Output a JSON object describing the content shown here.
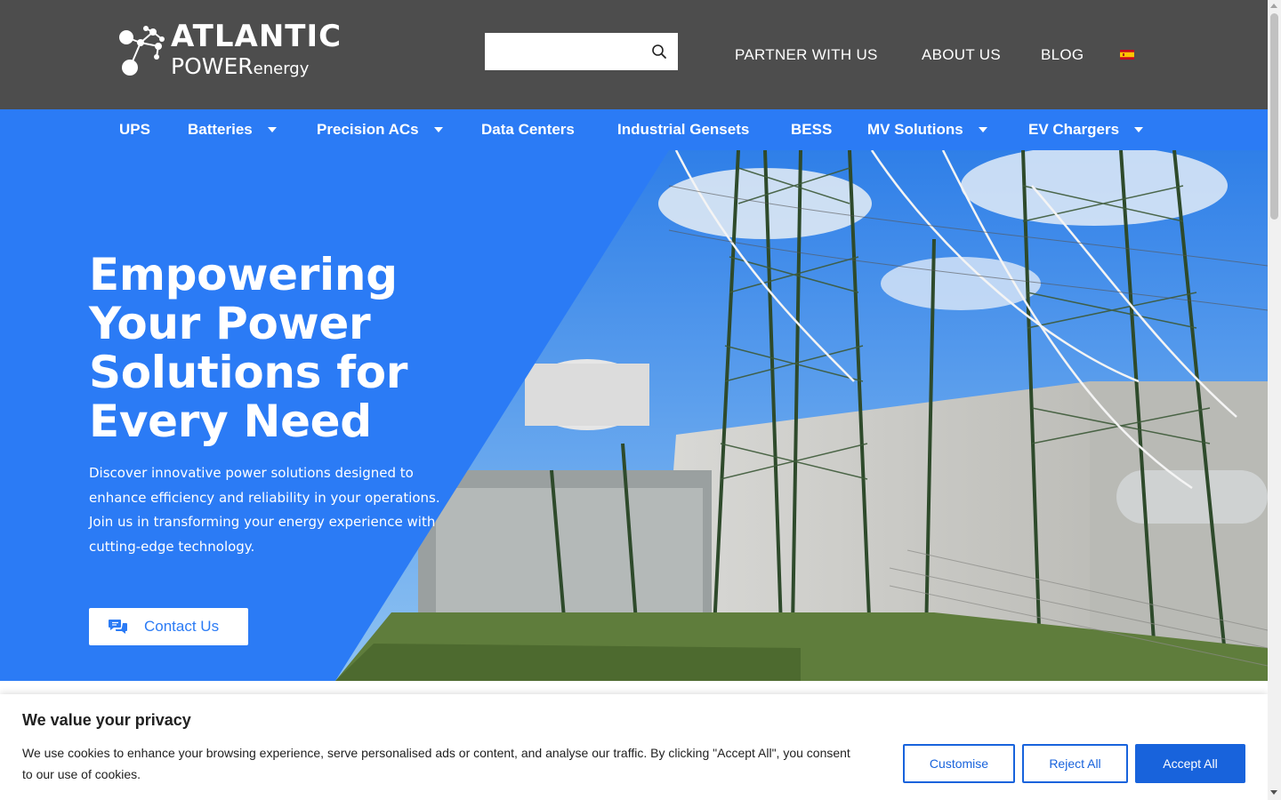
{
  "header": {
    "logo": {
      "line1": "ATLANTIC",
      "line2_main": "POWER",
      "line2_small": "energy"
    },
    "search": {
      "placeholder": "",
      "value": "",
      "icon": "search-icon"
    },
    "links": [
      {
        "label": "PARTNER WITH US"
      },
      {
        "label": "ABOUT US"
      },
      {
        "label": "BLOG"
      }
    ],
    "language_flag": "spain-flag-icon"
  },
  "main_nav": {
    "items": [
      {
        "label": "UPS",
        "has_dropdown": false
      },
      {
        "label": "Batteries",
        "has_dropdown": true
      },
      {
        "label": "Precision ACs",
        "has_dropdown": true
      },
      {
        "label": "Data Centers",
        "has_dropdown": false
      },
      {
        "label": "Industrial Gensets",
        "has_dropdown": false
      },
      {
        "label": "BESS",
        "has_dropdown": false
      },
      {
        "label": "MV Solutions",
        "has_dropdown": true
      },
      {
        "label": "EV Chargers",
        "has_dropdown": true
      }
    ]
  },
  "hero": {
    "title_lines": [
      "Empowering",
      "Your Power",
      "Solutions for",
      "Every Need"
    ],
    "text_lines": [
      "Discover innovative power solutions designed to",
      "enhance efficiency and reliability in your operations.",
      "Join us in transforming your energy experience with",
      "cutting-edge technology."
    ],
    "cta_label": "Contact Us",
    "cta_icon": "chat-icon"
  },
  "cookie_banner": {
    "title": "We value your privacy",
    "text_lines": [
      "We use cookies to enhance your browsing experience, serve personalised ads or content, and analyse our traffic. By clicking \"Accept All\", you consent",
      "to our use of cookies."
    ],
    "buttons": {
      "customise": "Customise",
      "reject": "Reject All",
      "accept": "Accept All"
    }
  },
  "colors": {
    "header_bg": "#4d4d4d",
    "brand_blue": "#2b7bf5",
    "cookie_blue": "#1863dc",
    "white": "#ffffff"
  }
}
